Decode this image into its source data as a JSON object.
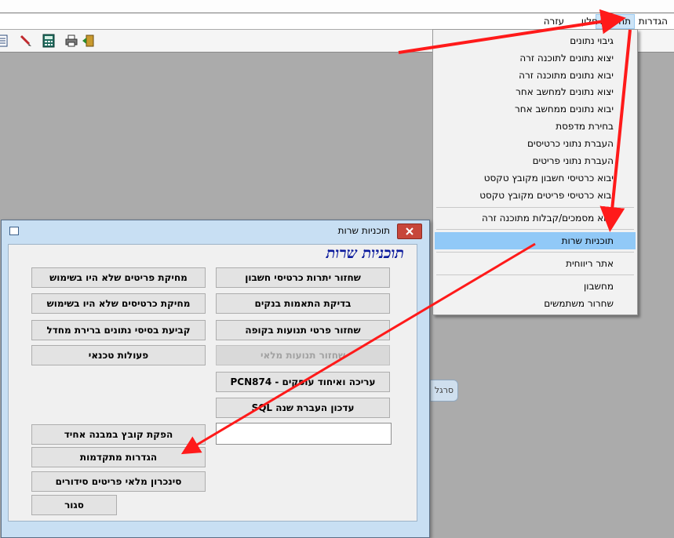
{
  "menubar": {
    "items": [
      {
        "label": "הגדרות",
        "active": false
      },
      {
        "label": "תחזוקה",
        "active": true
      },
      {
        "label": "חלון",
        "active": false
      },
      {
        "label": "עזרה",
        "active": false
      }
    ]
  },
  "toolbar": {
    "icons": [
      "list-icon",
      "pen-icon",
      "calculator-icon",
      "printer-icon",
      "exit-door-icon"
    ]
  },
  "maintenance_menu": {
    "items": [
      "גיבוי נתונים",
      "יצוא נתונים לתוכנה זרה",
      "יבוא נתונים מתוכנה זרה",
      "יצוא נתונים למחשב אחר",
      "יבוא נתונים ממחשב אחר",
      "בחירת מדפסת",
      "העברת נתוני כרטיסים",
      "העברת נתוני פריטים",
      "יבוא כרטיסי חשבון מקובץ טקסט",
      "יבוא כרטיסי פריטים מקובץ טקסט",
      "יבוא מסמכים/קבלות מתוכנה זרה",
      "תוכניות שרות",
      "אתר ריווחית",
      "מחשבון",
      "שחרור משתמשים"
    ],
    "highlighted": "תוכניות שרות"
  },
  "dialog": {
    "title": "תוכניות שרות",
    "heading": "תוכניות שרות",
    "right_buttons": [
      {
        "label": "שחזור יתרות כרטיסי חשבון",
        "enabled": true
      },
      {
        "label": "בדיקת התאמות בנקים",
        "enabled": true
      },
      {
        "label": "שחזור פרטי תנועות בקופה",
        "enabled": true
      },
      {
        "label": "שחזור תנועות מלאי",
        "enabled": false
      },
      {
        "label": "עריכה ואיחוד עוסקים - PCN874",
        "enabled": true
      },
      {
        "label": "עדכון העברת שנה SQL",
        "enabled": true
      }
    ],
    "left_buttons": [
      {
        "label": "מחיקת פריטים שלא היו בשימוש"
      },
      {
        "label": "מחיקת כרטיסים שלא היו בשימוש"
      },
      {
        "label": "קביעת בסיסי נתונים ברירת מחדל"
      },
      {
        "label": "פעולות טכנאי"
      }
    ],
    "bottom_buttons": [
      {
        "label": "הפקת קובץ במבנה אחיד"
      },
      {
        "label": "הגדרות מתקדמות"
      },
      {
        "label": "סינכרון מלאי פריטים סידורים"
      }
    ],
    "close_label": "סגור"
  },
  "side_tab": {
    "label": "סרגל"
  },
  "colors": {
    "annotation_arrow": "#ff1a1a",
    "menu_highlight": "#91c9f7",
    "dialog_heading": "#0b1a9c"
  }
}
